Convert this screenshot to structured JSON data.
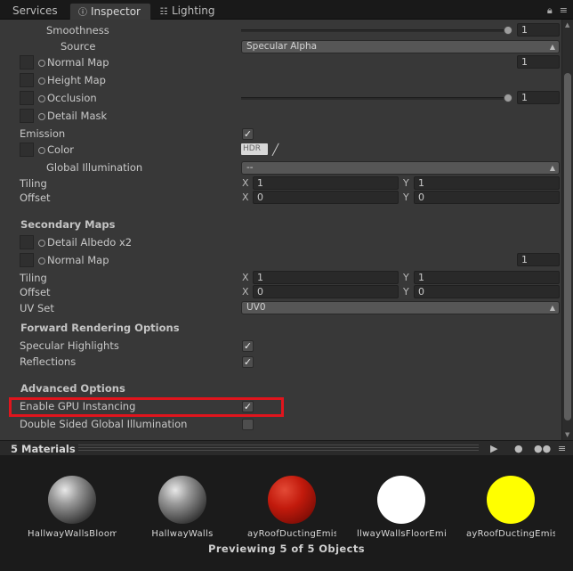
{
  "tabs": [
    {
      "label": "Services",
      "icon": ""
    },
    {
      "label": "Inspector",
      "icon": "info-icon"
    },
    {
      "label": "Lighting",
      "icon": "lighting-icon"
    }
  ],
  "main_maps": {
    "smoothness_label": "Smoothness",
    "smoothness_value": "1",
    "source_label": "Source",
    "source_value": "Specular Alpha",
    "normal_map_label": "Normal Map",
    "normal_map_value": "1",
    "height_map_label": "Height Map",
    "occlusion_label": "Occlusion",
    "occlusion_value": "1",
    "detail_mask_label": "Detail Mask",
    "emission_label": "Emission",
    "emission_checked": true,
    "color_label": "Color",
    "color_hdr": "HDR",
    "gi_label": "Global Illumination",
    "gi_value": "--",
    "tiling_label": "Tiling",
    "tiling_x": "1",
    "tiling_y": "1",
    "offset_label": "Offset",
    "offset_x": "0",
    "offset_y": "0",
    "x_label": "X",
    "y_label": "Y"
  },
  "secondary_maps": {
    "header": "Secondary Maps",
    "detail_albedo_label": "Detail Albedo x2",
    "normal_map_label": "Normal Map",
    "normal_map_value": "1",
    "tiling_label": "Tiling",
    "tiling_x": "1",
    "tiling_y": "1",
    "offset_label": "Offset",
    "offset_x": "0",
    "offset_y": "0",
    "uv_set_label": "UV Set",
    "uv_set_value": "UV0"
  },
  "forward_rendering": {
    "header": "Forward Rendering Options",
    "specular_label": "Specular Highlights",
    "specular_checked": true,
    "reflections_label": "Reflections",
    "reflections_checked": true
  },
  "advanced": {
    "header": "Advanced Options",
    "gpu_instancing_label": "Enable GPU Instancing",
    "gpu_instancing_checked": true,
    "double_sided_label": "Double Sided Global Illumination",
    "double_sided_checked": false
  },
  "preview": {
    "title": "5 Materials",
    "status": "Previewing 5 of 5 Objects",
    "materials": [
      {
        "name": "HallwayWallsBloom",
        "color": "#9a9a9a"
      },
      {
        "name": "HallwayWalls",
        "color": "#9a9a9a"
      },
      {
        "name": "ayRoofDuctingEmissiv",
        "color": "#c21a0c"
      },
      {
        "name": "llwayWallsFloorEmissi",
        "color": "#ffffff"
      },
      {
        "name": "ayRoofDuctingEmissiv",
        "color": "#ffff00"
      }
    ]
  },
  "colors": {
    "highlight": "#e0151d",
    "panel": "#383838",
    "field": "#292929"
  }
}
